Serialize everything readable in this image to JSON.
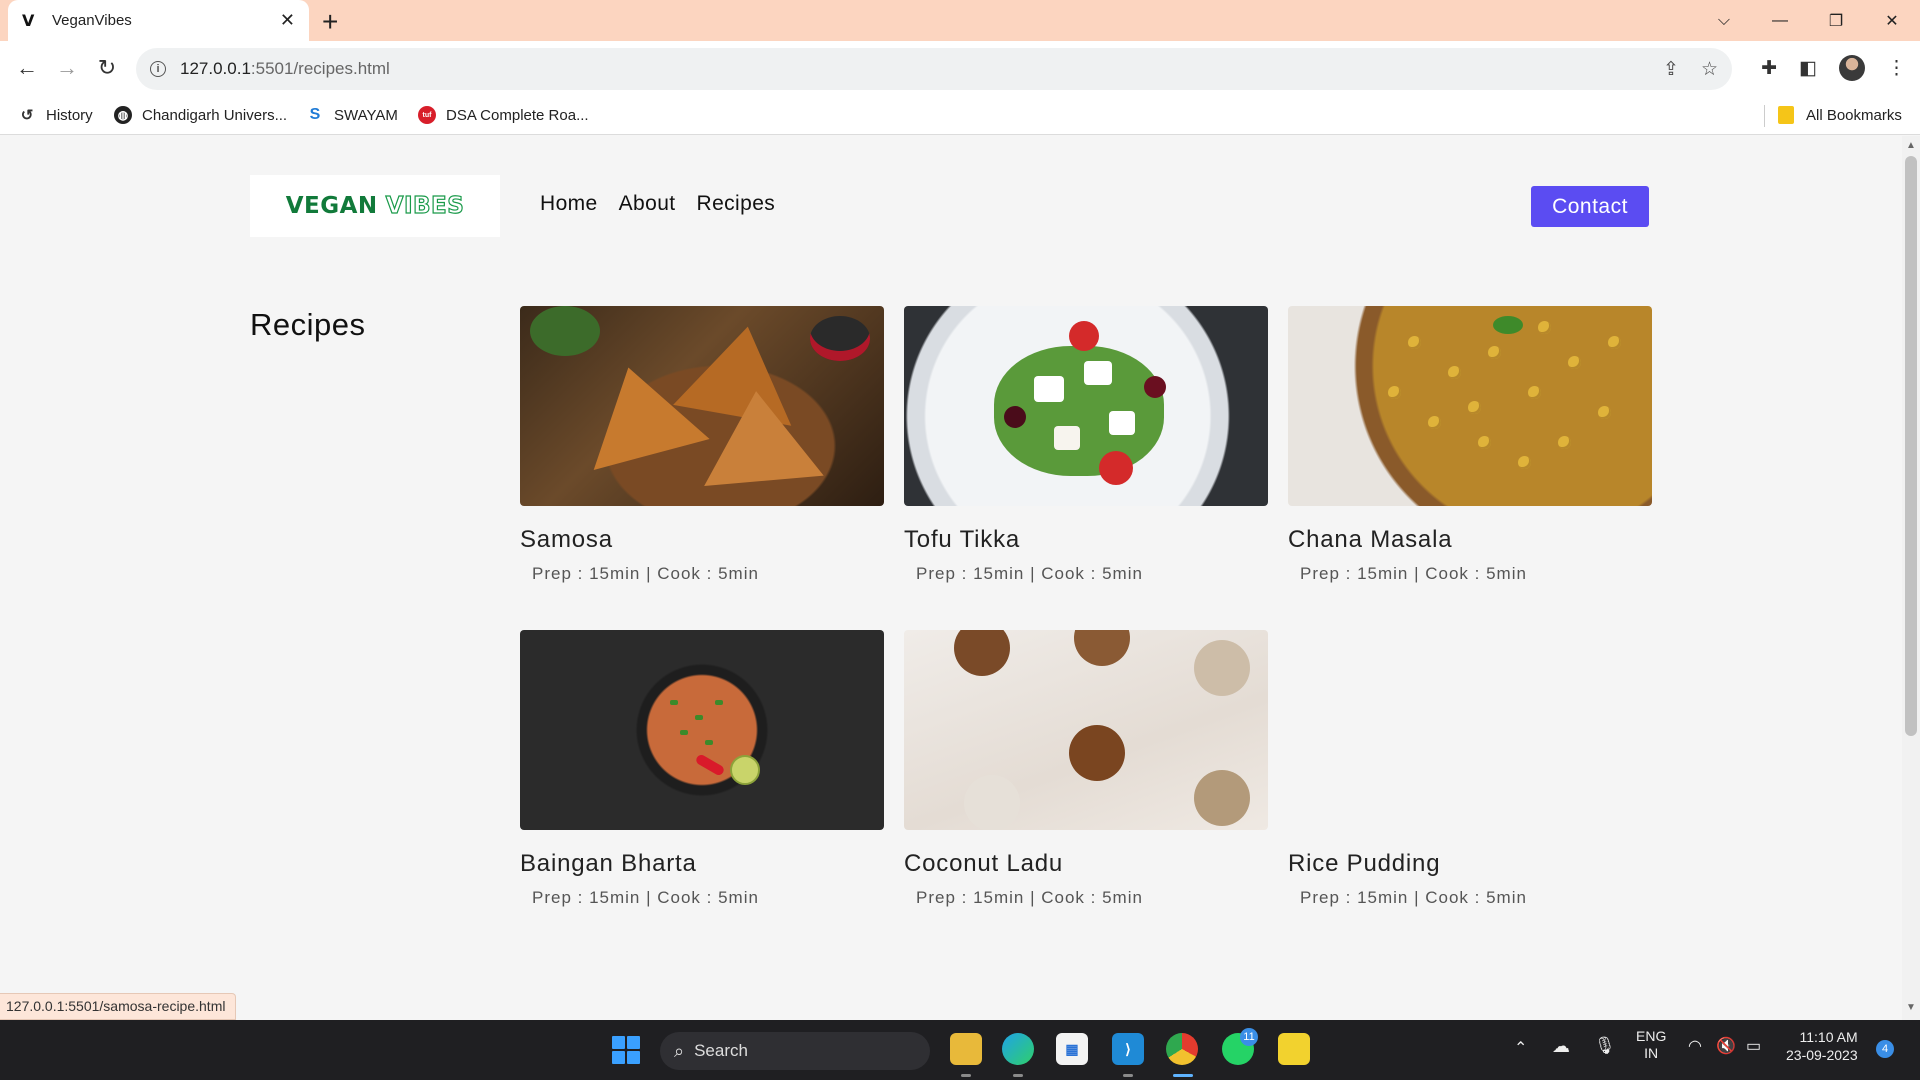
{
  "browser": {
    "tab": {
      "favicon": "V",
      "title": "VeganVibes",
      "close": "✕"
    },
    "new_tab": "+",
    "window_controls": {
      "dropdown": "⌵",
      "minimize": "—",
      "restore": "❐",
      "close": "✕"
    },
    "nav": {
      "back": "←",
      "forward": "→",
      "reload": "↻"
    },
    "url": {
      "host": "127.0.0.1",
      "rest": ":5501/recipes.html"
    },
    "bookmarks": [
      {
        "label": "History"
      },
      {
        "label": "Chandigarh Univers..."
      },
      {
        "label": "SWAYAM"
      },
      {
        "label": "DSA Complete Roa..."
      }
    ],
    "all_bookmarks": "All Bookmarks",
    "status_url": "127.0.0.1:5501/samosa-recipe.html"
  },
  "site": {
    "logo": {
      "part1": "VEGAN",
      "part2": "VIBES"
    },
    "nav": [
      "Home",
      "About",
      "Recipes"
    ],
    "contact": "Contact",
    "page_title": "Recipes",
    "recipes": [
      {
        "name": "Samosa",
        "meta": "Prep : 15min | Cook : 5min",
        "image": "samosa"
      },
      {
        "name": "Tofu Tikka",
        "meta": "Prep : 15min | Cook : 5min",
        "image": "salad"
      },
      {
        "name": "Chana Masala",
        "meta": "Prep : 15min | Cook : 5min",
        "image": "chana"
      },
      {
        "name": "Baingan Bharta",
        "meta": "Prep : 15min | Cook : 5min",
        "image": "bharta"
      },
      {
        "name": "Coconut Ladu",
        "meta": "Prep : 15min | Cook : 5min",
        "image": "ladu"
      },
      {
        "name": "Rice Pudding",
        "meta": "Prep : 15min | Cook : 5min",
        "image": "none"
      }
    ]
  },
  "taskbar": {
    "search_placeholder": "Search",
    "whatsapp_badge": "11",
    "lang": "ENG",
    "region": "IN",
    "time": "11:10 AM",
    "date": "23-09-2023",
    "notifications": "4"
  }
}
